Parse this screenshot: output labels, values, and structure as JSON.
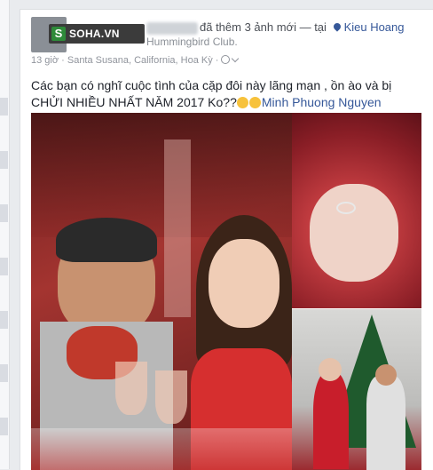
{
  "post": {
    "logo_letter": "S",
    "logo_text": "SOHA.VN",
    "header_text": "đã thêm 3 ảnh mới — tại",
    "place_name": "Kieu Hoang",
    "place_sub": "Hummingbird Club.",
    "time": "13 giờ",
    "location": "Santa Susana, California, Hoa Kỳ",
    "status_text": "Các bạn có nghĩ cuộc tình của cặp đôi này lãng mạn , ồn ào và bị CHỬI NHIỀU NHẤT NĂM 2017 Ko??",
    "mention": "Minh Phuong Nguyen",
    "photo_count": 3
  },
  "colors": {
    "link": "#365899",
    "text": "#1d2129",
    "meta": "#90949c"
  }
}
